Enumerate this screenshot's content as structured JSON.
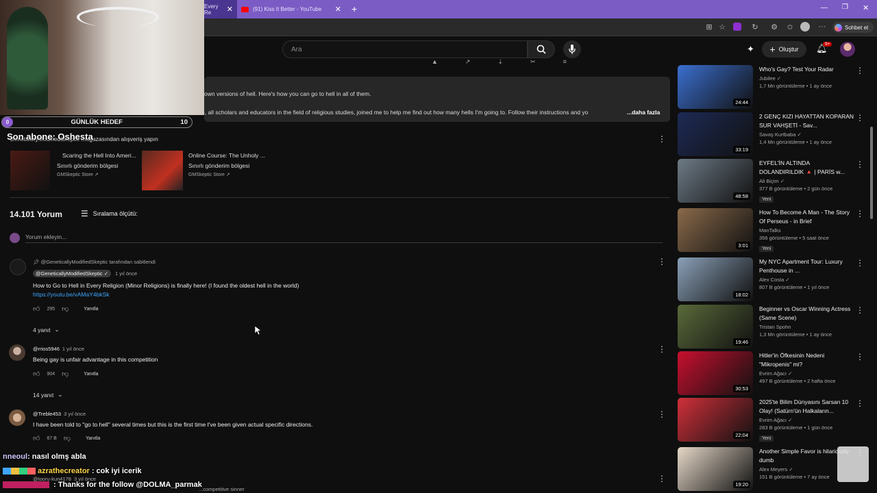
{
  "browser": {
    "tabs": [
      {
        "label": "Every Re"
      },
      {
        "label": "(91) Kiss It Better - YouTube"
      }
    ],
    "sohbet_label": "Sohbet et"
  },
  "yt": {
    "search_placeholder": "Ara",
    "create_label": "Oluştur",
    "notif_count": "9+"
  },
  "description": {
    "line1": "own versions of hell. Here's how you can go to hell in all of them.",
    "line2": "e, all scholars and educators in the field of religious studies, joined me to help me find out how many hells I'm going to. Follow their instructions and yo",
    "more": "...daha fazla"
  },
  "stream_overlay": {
    "goal_label": "GÜNLÜK HEDEF",
    "goal_left": "0",
    "goal_right": "10",
    "last_sub": "Son abone: Oshesta",
    "chat": [
      {
        "user": "nneoul",
        "msg": ": nasıl olmş abla"
      },
      {
        "user": "azrathecreator",
        "msg": ": cok iyi icerik"
      },
      {
        "user": "",
        "msg": ": Thanks for the follow @DOLMA_parmak"
      }
    ]
  },
  "store": {
    "header": "GeneticallyModifiedSkeptic mağazasından alışveriş yapın",
    "products": [
      {
        "title": "Scaring the Hell Into Ameri...",
        "sub": "Sınırlı gönderim bölgesi",
        "store": "GMSkeptic Store ↗"
      },
      {
        "title": "Online Course: The Unholy ...",
        "sub": "Sınırlı gönderim bölgesi",
        "store": "GMSkeptic Store ↗"
      }
    ]
  },
  "comments": {
    "count": "14.101 Yorum",
    "sort_label": "Sıralama ölçütü:",
    "add_placeholder": "Yorum ekleyin...",
    "reply_label": "Yanıtla",
    "items": [
      {
        "pinned": "@GeneticallyModifiedSkeptic tarafından sabitlendi",
        "author": "@GeneticallyModifiedSkeptic ✓",
        "time": "1 yıl önce",
        "text": "How to Go to Hell in Every Religion (Minor Religions) is finally here! (I found the oldest hell in the world)",
        "link": "https://youtu.be/vAMaY4bkSk",
        "likes": "295",
        "replies": "4 yanıt"
      },
      {
        "author": "@rrios5946",
        "time": "1 yıl önce",
        "text": "Being gay is unfair advantage in this competition",
        "likes": "904",
        "replies": "14 yanıt"
      },
      {
        "author": "@Treble453",
        "time": "3 yıl önce",
        "text": "I have been told to \"go to hell\" several times but this is the first time I've been given actual specific directions.",
        "likes": "67 B"
      },
      {
        "author": "@tooru-kun4178",
        "time": "3 yıl önce",
        "text": "...competitive sinner"
      }
    ]
  },
  "recommendations": [
    {
      "title": "Who's Gay? Test Your Radar",
      "channel": "Jubilee ✓",
      "meta": "1,7 Mn görüntüleme • 1 ay önce",
      "duration": "24:44",
      "new": "",
      "color": "#3b6fd0"
    },
    {
      "title": "2 GENÇ KIZI HAYATTAN KOPARAN SUR VAHŞETİ - Sav...",
      "channel": "Savaş Kurtbaba ✓",
      "meta": "1,4 Mn görüntüleme • 1 ay önce",
      "duration": "33:19",
      "new": "",
      "color": "#1d2a55"
    },
    {
      "title": "EYFEL'İN ALTINDA DOLANDIRILDIK 🔺 | PARİS w...",
      "channel": "Ali Biçim ✓",
      "meta": "377 B görüntüleme • 2 gün önce",
      "duration": "48:58",
      "new": "Yeni",
      "color": "#6d7a86"
    },
    {
      "title": "How To Become A Man - The Story Of Perseus - in Brief",
      "channel": "ManTalks",
      "meta": "356 görüntüleme • 5 saat önce",
      "duration": "3:01",
      "new": "Yeni",
      "color": "#8a6a4a"
    },
    {
      "title": "My NYC Apartment Tour: Luxury Penthouse in ...",
      "channel": "Alex Costa ✓",
      "meta": "807 B görüntüleme • 1 yıl önce",
      "duration": "18:02",
      "new": "",
      "color": "#8aa0b8"
    },
    {
      "title": "Beginner vs Oscar Winning Actress (Same Scene)",
      "channel": "Tristan Spohn",
      "meta": "1,3 Mn görüntüleme • 1 ay önce",
      "duration": "19:46",
      "new": "",
      "color": "#5a6a3a"
    },
    {
      "title": "Hitler'in Öfkesinin Nedeni \"Mikropenis\" mi?",
      "channel": "Evrim Ağacı ✓",
      "meta": "497 B görüntüleme • 2 hafta önce",
      "duration": "30:53",
      "new": "",
      "color": "#c8102e"
    },
    {
      "title": "2025'te Bilim Dünyasını Sarsan 10 Olay! (Satürn'ün Halkaların...",
      "channel": "Evrim Ağacı ✓",
      "meta": "283 B görüntüleme • 1 gün önce",
      "duration": "22:04",
      "new": "Yeni",
      "color": "#d0303a"
    },
    {
      "title": "Another Simple Favor is hilariously dumb",
      "channel": "Alex Meyers ✓",
      "meta": "151 B görüntüleme • 7 ay önce",
      "duration": "19:20",
      "new": "",
      "color": "#e6d8c8"
    }
  ]
}
